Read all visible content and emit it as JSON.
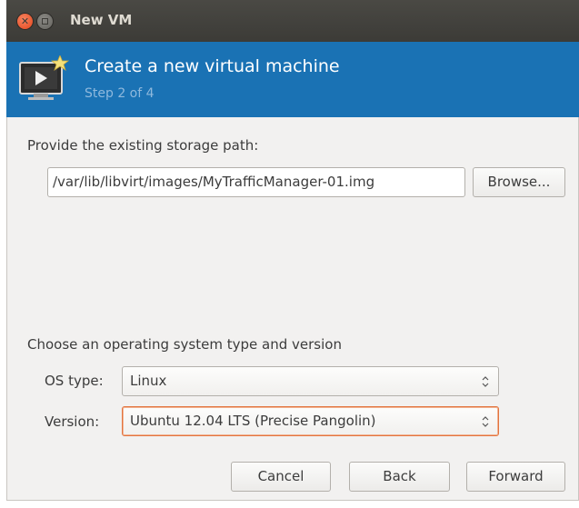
{
  "titlebar": {
    "title": "New VM",
    "close_icon": "close-icon",
    "minimize_icon": "minimize-icon"
  },
  "header": {
    "title": "Create a new virtual machine",
    "step": "Step 2 of 4",
    "icon": "new-vm-monitor-icon",
    "background_color": "#1a72b4"
  },
  "storage": {
    "label": "Provide the existing storage path:",
    "path_value": "/var/lib/libvirt/images/MyTrafficManager-01.img",
    "browse_label": "Browse..."
  },
  "os": {
    "section_label": "Choose an operating system type and version",
    "type_label": "OS type:",
    "type_value": "Linux",
    "version_label": "Version:",
    "version_value": "Ubuntu 12.04 LTS (Precise Pangolin)"
  },
  "buttons": {
    "cancel": "Cancel",
    "back": "Back",
    "forward": "Forward"
  },
  "colors": {
    "focus_accent": "#e3743e",
    "close_button": "#e2461d"
  }
}
